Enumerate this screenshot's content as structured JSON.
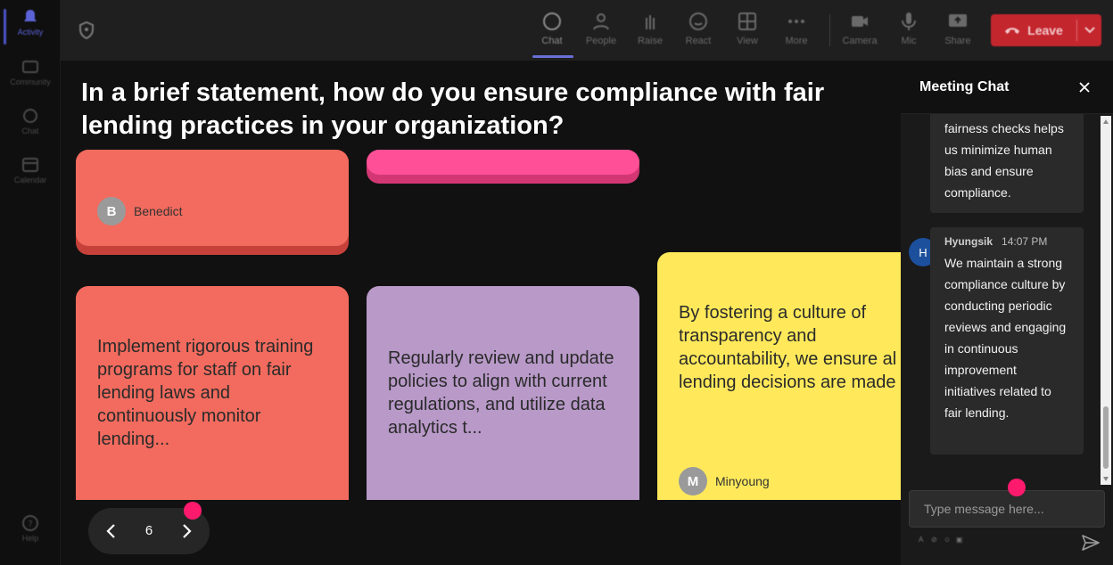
{
  "rail": {
    "items": [
      {
        "label": "Activity",
        "icon": "bell-icon"
      },
      {
        "label": "Community",
        "icon": "community-icon"
      },
      {
        "label": "Chat",
        "icon": "chat-icon"
      },
      {
        "label": "Calendar",
        "icon": "calendar-icon"
      }
    ],
    "help": "Help"
  },
  "toolbar": {
    "chat": "Chat",
    "people": "People",
    "raise": "Raise",
    "react": "React",
    "view": "View",
    "more": "More",
    "camera": "Camera",
    "mic": "Mic",
    "share": "Share",
    "leave": "Leave"
  },
  "stage": {
    "question": "In a brief statement, how do you ensure compliance with fair lending practices in your organization?",
    "cards": [
      {
        "author": "Benedict",
        "initial": "B",
        "text": ""
      },
      {
        "author": "",
        "initial": "",
        "text": ""
      },
      {
        "text": "Implement rigorous training programs for staff on fair lending laws and continuously monitor lending..."
      },
      {
        "text": "Regularly review and update policies to align with current regulations, and utilize data analytics t..."
      },
      {
        "text": "By fostering a culture of transparency and accountability, we ensure al lending decisions are made ...",
        "author": "Minyoung",
        "initial": "M"
      }
    ],
    "page": "6"
  },
  "chat": {
    "title": "Meeting Chat",
    "messages": [
      {
        "sender": "",
        "time": "",
        "text": "fairness checks helps us minimize human bias and ensure compliance."
      },
      {
        "sender": "Hyungsik",
        "time": "14:07 PM",
        "initial": "H",
        "text": "We maintain a strong compliance culture by conducting periodic reviews and engaging in continuous improvement initiatives related to fair lending."
      }
    ],
    "input_placeholder": "Type message here..."
  },
  "colors": {
    "card_red": "#f26b5e",
    "card_red_shadow": "#c6413a",
    "card_pink": "#ff4f96",
    "card_pink_shadow": "#d23774",
    "card_purple": "#b899c8",
    "card_yellow": "#ffe95a",
    "leave_red": "#c4262e",
    "accent_dot": "#ff1a6e"
  }
}
